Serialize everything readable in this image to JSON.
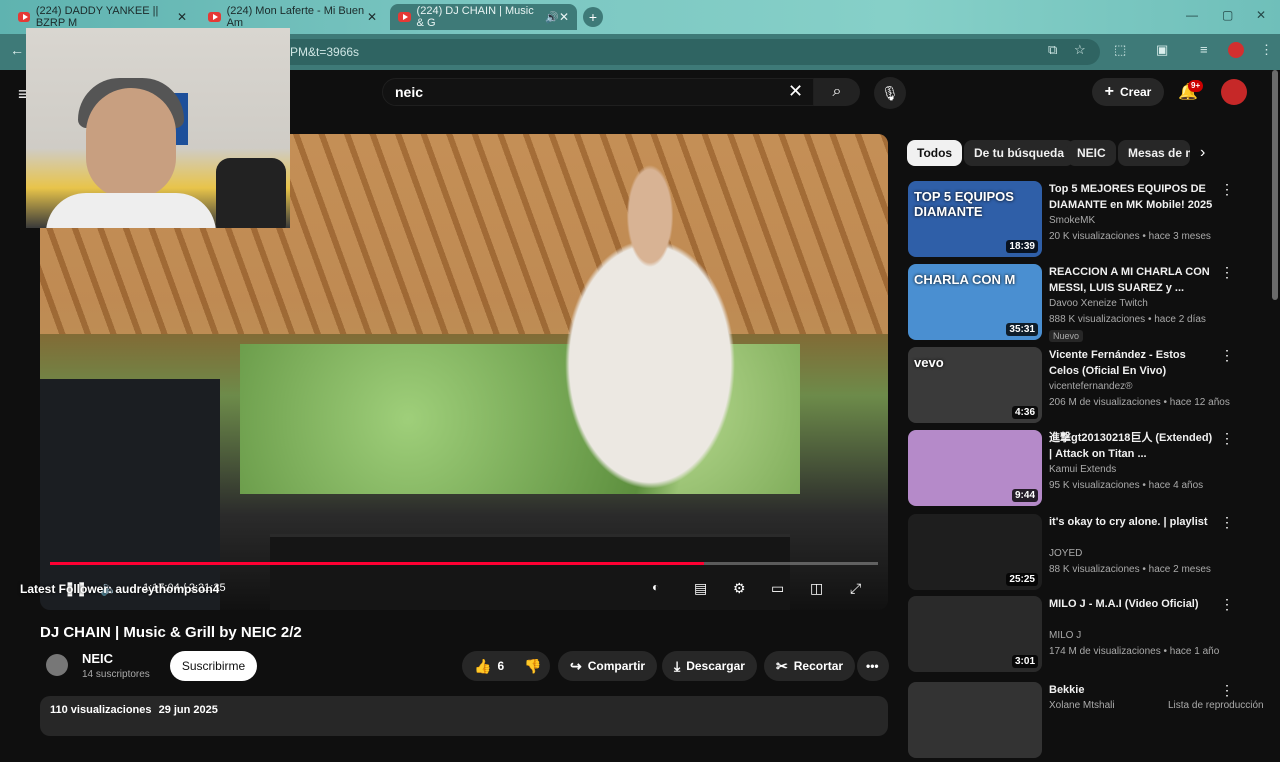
{
  "browser": {
    "tabs": [
      {
        "title": "(224) DADDY YANKEE || BZRP M"
      },
      {
        "title": "(224) Mon Laferte - Mi Buen Am"
      },
      {
        "title": "(224) DJ CHAIN | Music & G"
      }
    ],
    "url_fragment": "PM&t=3966s"
  },
  "header": {
    "search_query": "neic",
    "create_label": "Crear",
    "notif_count": "9+"
  },
  "player": {
    "time": "1:17:04 / 2:31:35",
    "progress_fraction": 0.79
  },
  "overlay": {
    "text": "Latest Follower: audreythompson4"
  },
  "video": {
    "title": "DJ CHAIN | Music & Grill by NEIC 2/2",
    "channel": "NEIC",
    "subscribers": "14 suscriptores",
    "subscribe_label": "Suscribirme",
    "likes": "6",
    "share_label": "Compartir",
    "download_label": "Descargar",
    "clip_label": "Recortar",
    "views": "110 visualizaciones",
    "date": "29 jun 2025"
  },
  "chips": [
    "Todos",
    "De tu búsqueda",
    "NEIC",
    "Mesas de m"
  ],
  "recommendations": [
    {
      "title": "Top 5 MEJORES EQUIPOS DE DIAMANTE en MK Mobile! 2025",
      "channel": "SmokeMK",
      "views": "20 K visualizaciones",
      "age": "hace 3 meses",
      "duration": "18:39",
      "thumb_text": "TOP 5 EQUIPOS DIAMANTE",
      "color": "#2f5fa8"
    },
    {
      "title": "REACCION A MI CHARLA CON MESSI, LUIS SUAREZ y ...",
      "channel": "Davoo Xeneize Twitch",
      "views": "888 K visualizaciones",
      "age": "hace 2 días",
      "duration": "35:31",
      "thumb_text": "CHARLA CON M",
      "badge": "Nuevo",
      "color": "#4a8fd1"
    },
    {
      "title": "Vicente Fernández - Estos Celos (Oficial En Vivo)",
      "channel": "vicentefernandez®",
      "views": "206 M de visualizaciones",
      "age": "hace 12 años",
      "duration": "4:36",
      "thumb_text": "vevo",
      "color": "#3a3a3a"
    },
    {
      "title": "進撃gt20130218巨人 (Extended) | Attack on Titan ...",
      "channel": "Kamui Extends",
      "views": "95 K visualizaciones",
      "age": "hace 4 años",
      "duration": "9:44",
      "color": "#b58ac9"
    },
    {
      "title": "it's okay to cry alone. | playlist",
      "channel": "JOYED",
      "views": "88 K visualizaciones",
      "age": "hace 2 meses",
      "duration": "25:25",
      "color": "#1e1e1e"
    },
    {
      "title": "MILO J - M.A.I (Video Oficial)",
      "channel": "MILO J",
      "views": "174 M de visualizaciones",
      "age": "hace 1 año",
      "duration": "3:01",
      "color": "#2a2a2a"
    },
    {
      "title": "Bekkie",
      "channel": "Xolane Mtshali",
      "views": "Lista de reproducción",
      "age": "",
      "duration": "",
      "color": "#333333"
    }
  ]
}
